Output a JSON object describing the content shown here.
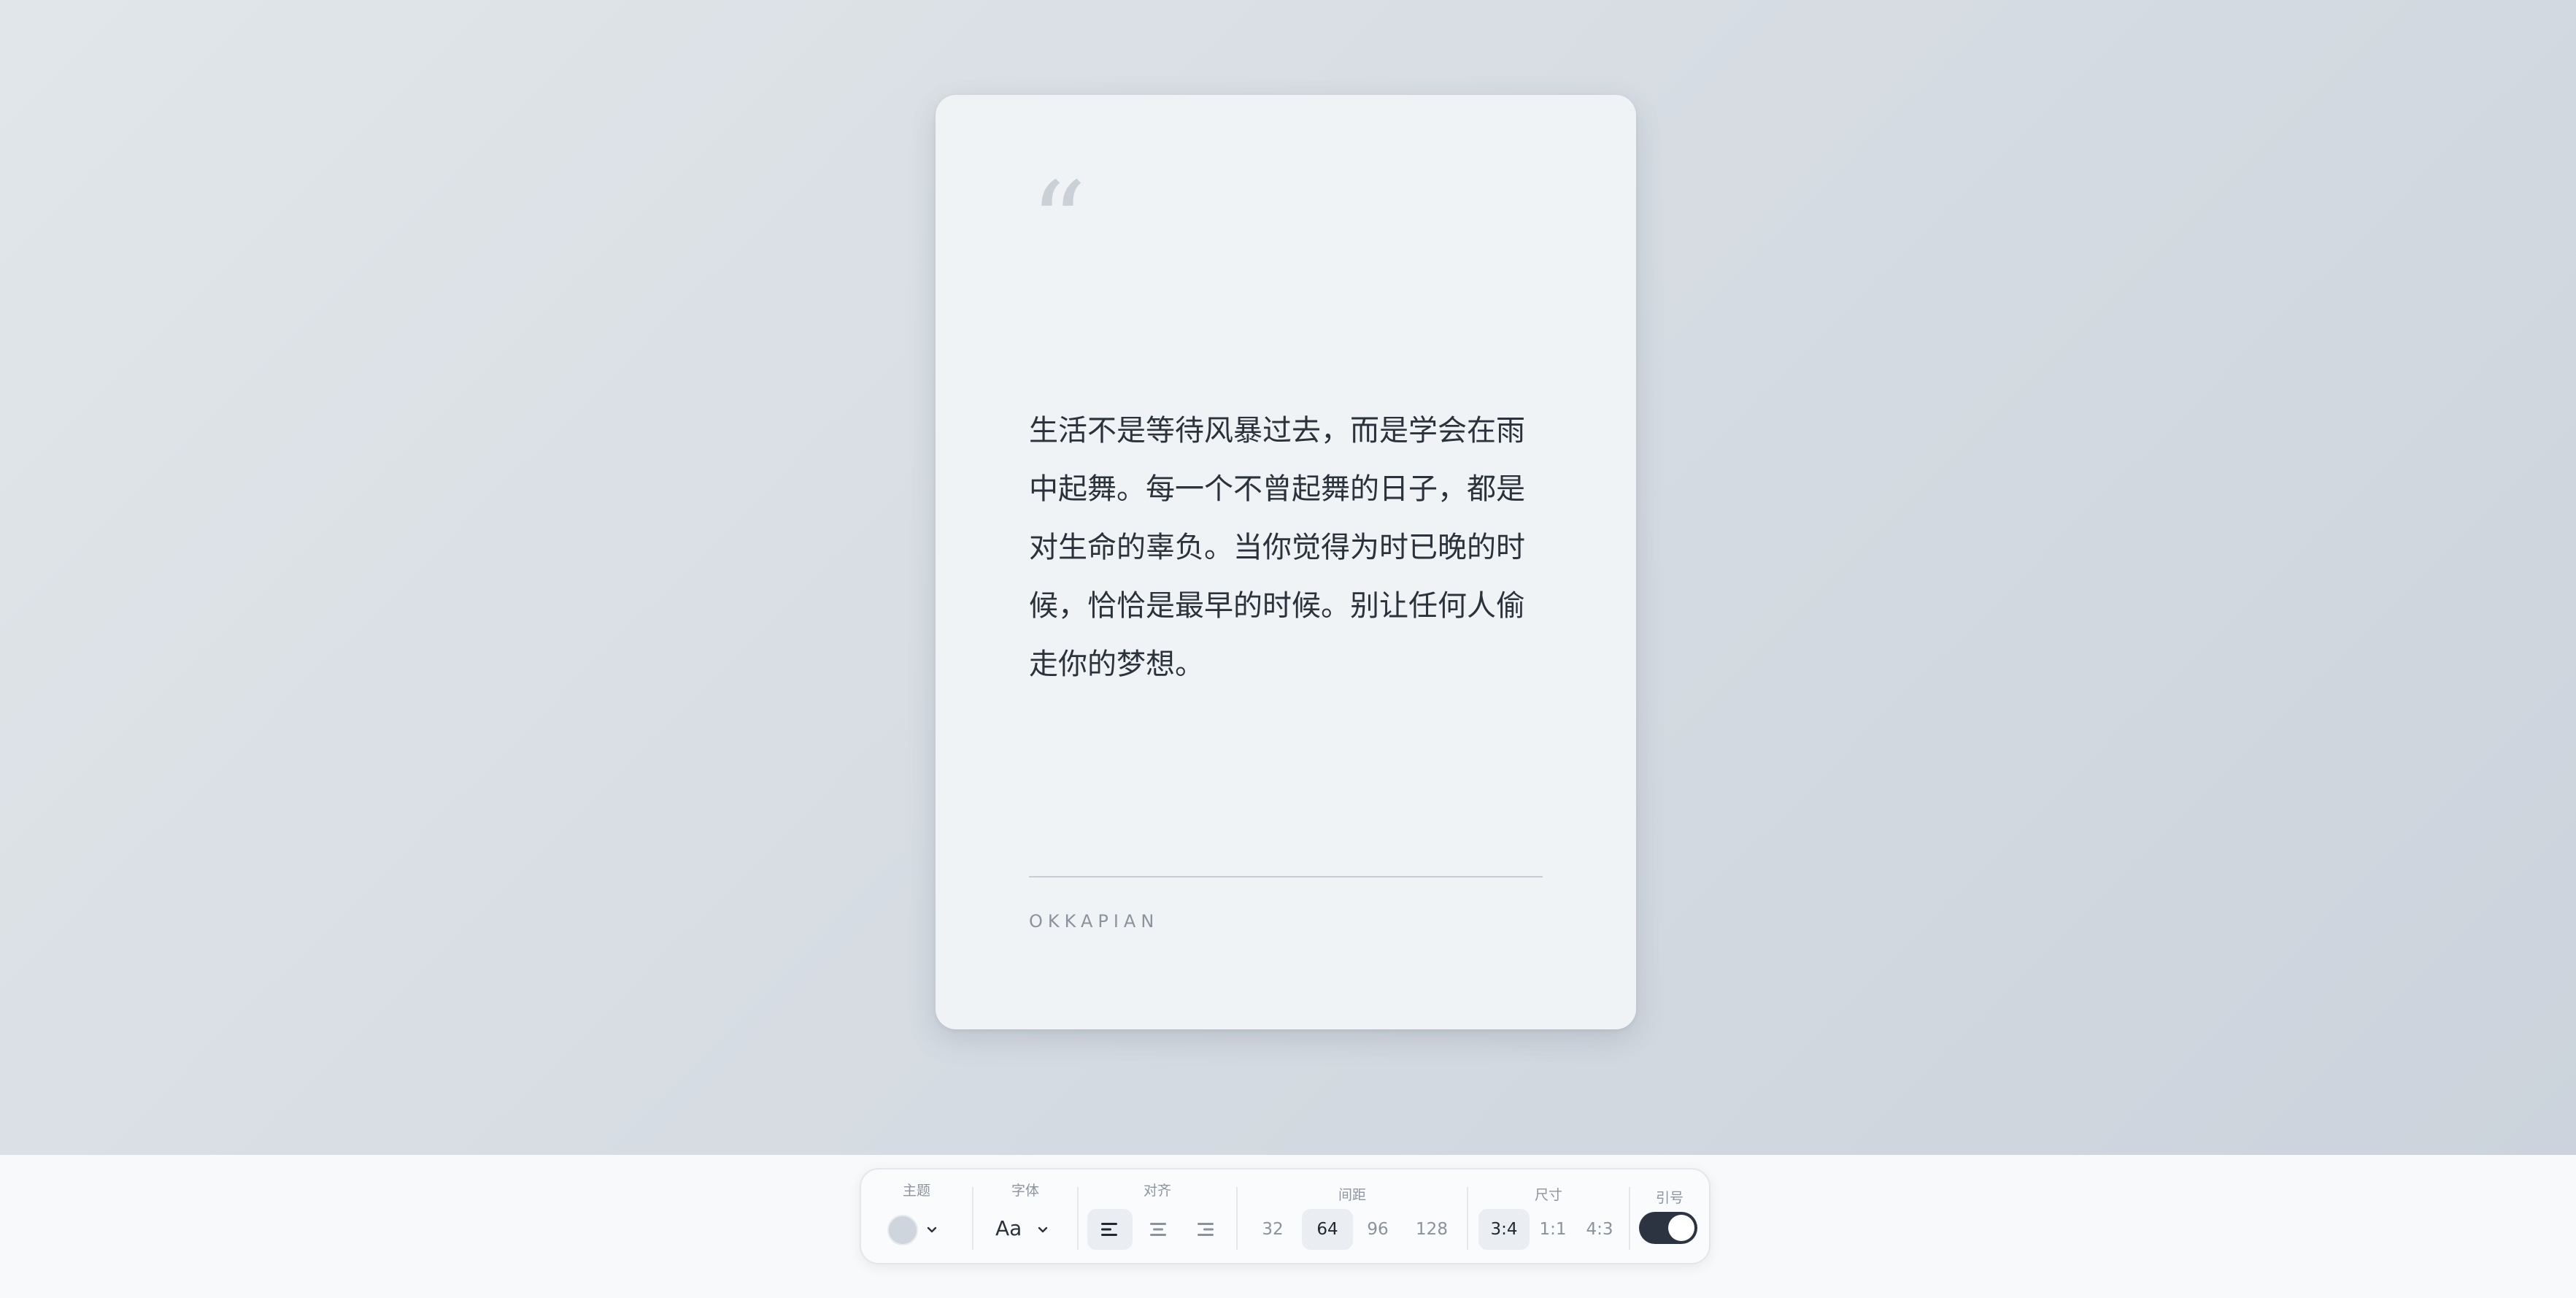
{
  "card": {
    "quote_mark": "“",
    "quote_text": "生活不是等待风暴过去，而是学会在雨中起舞。每一个不曾起舞的日子，都是对生命的辜负。当你觉得为时已晚的时候，恰恰是最早的时候。别让任何人偷走你的梦想。",
    "author": "OKKAPIAN"
  },
  "toolbar": {
    "theme": {
      "label": "主题",
      "swatch_color": "#ced5dc",
      "icon": "chevron-down-icon"
    },
    "font": {
      "label": "字体",
      "value": "Aa",
      "icon": "chevron-down-icon"
    },
    "align": {
      "label": "对齐",
      "options": [
        {
          "icon": "align-left-icon",
          "active": true
        },
        {
          "icon": "align-center-icon",
          "active": false
        },
        {
          "icon": "align-right-icon",
          "active": false
        }
      ]
    },
    "spacing": {
      "label": "间距",
      "options": [
        "32",
        "64",
        "96",
        "128"
      ],
      "selected": "64"
    },
    "size": {
      "label": "尺寸",
      "options": [
        "3:4",
        "1:1",
        "4:3"
      ],
      "selected": "3:4"
    },
    "quote_toggle": {
      "label": "引号",
      "on": true
    }
  },
  "colors": {
    "accent": "#2b3440",
    "card_bg": "#f0f3f5",
    "text": "#2a323b"
  }
}
